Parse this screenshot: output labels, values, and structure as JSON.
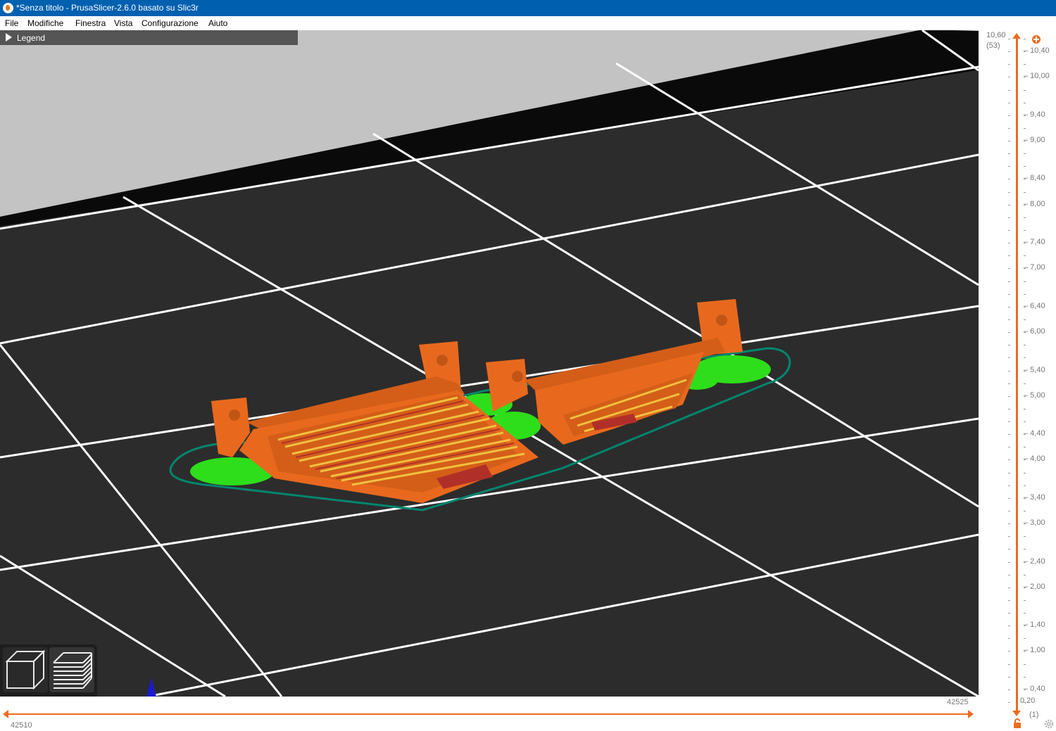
{
  "window": {
    "title": "*Senza titolo - PrusaSlicer-2.6.0 basato su Slic3r"
  },
  "menu": [
    "File",
    "Modifiche",
    "Finestra",
    "Vista",
    "Configurazione",
    "Aiuto"
  ],
  "legend": {
    "label": "Legend"
  },
  "vertical_slider": {
    "top_value": "10,60",
    "top_layer": "(53)",
    "bottom_value": "0,20",
    "bottom_layer": "(1)",
    "ticks": [
      "10,60",
      "10,40",
      "10,00",
      "9,40",
      "9,00",
      "8,40",
      "8,00",
      "7,40",
      "7,00",
      "6,40",
      "6,00",
      "5,40",
      "5,00",
      "4,40",
      "4,00",
      "3,40",
      "3,00",
      "2,40",
      "2,00",
      "1,40",
      "1,00",
      "0,40",
      "0,20"
    ]
  },
  "horizontal_slider": {
    "left_value": "42510",
    "right_value": "42525"
  },
  "colors": {
    "titlebar": "#0060b0",
    "accent": "#ed6b21",
    "bed": "#2c2c2c",
    "grid": "#ffffff",
    "perimeter": "#ff7f27",
    "infill": "#b03029",
    "solid_infill": "#d9c236",
    "support": "#00d200",
    "skirt": "#00876e",
    "overhang": "#1a1acc"
  },
  "icons": {
    "app": "prusaslicer-logo-icon",
    "legend_toggle": "triangle-right-icon",
    "view_3d": "cube-icon",
    "view_preview": "layers-icon",
    "lock": "lock-icon",
    "cog": "cog-icon"
  }
}
